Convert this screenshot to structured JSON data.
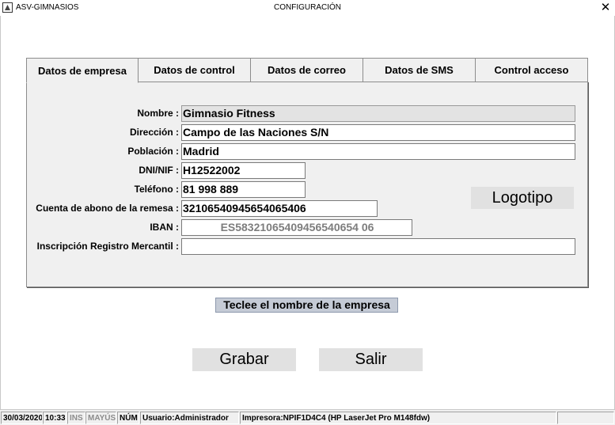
{
  "window": {
    "app_name": "ASV-GIMNASIOS",
    "title": "CONFIGURACIÓN",
    "close_glyph": "✕"
  },
  "tabs": [
    {
      "label": "Datos de empresa",
      "active": true
    },
    {
      "label": "Datos de control",
      "active": false
    },
    {
      "label": "Datos de correo",
      "active": false
    },
    {
      "label": "Datos de SMS",
      "active": false
    },
    {
      "label": "Control acceso",
      "active": false
    }
  ],
  "form": {
    "nombre": {
      "label": "Nombre :",
      "value": "Gimnasio Fitness"
    },
    "direccion": {
      "label": "Dirección :",
      "value": "Campo de las Naciones S/N"
    },
    "poblacion": {
      "label": "Población :",
      "value": "Madrid"
    },
    "dni": {
      "label": "DNI/NIF :",
      "value": "H12522002"
    },
    "telefono": {
      "label": "Teléfono :",
      "value": "81 998 889"
    },
    "cuenta": {
      "label": "Cuenta de abono de la remesa :",
      "value": "32106540945654065406"
    },
    "iban": {
      "label": "IBAN :",
      "value": "ES58321065409456540654 06"
    },
    "registro": {
      "label": "Inscripción Registro Mercantil :",
      "value": ""
    }
  },
  "logo_button": "Logotipo",
  "hint": "Teclee el nombre de la empresa",
  "buttons": {
    "save": "Grabar",
    "exit": "Salir"
  },
  "status": {
    "date": "30/03/2020",
    "time": "10:33",
    "ins": "INS",
    "caps": "MAYÚS",
    "num": "NÚM",
    "user": "Usuario:Administrador",
    "printer": "Impresora:NPIF1D4C4 (HP LaserJet Pro M148fdw)"
  },
  "colors": {
    "panel_bg": "#f0f0f0",
    "button_bg": "#e1e1e1",
    "hint_bg": "#c5cbd6",
    "readonly_field_bg": "#e3e3e3",
    "iban_text": "#7d7d7d"
  }
}
